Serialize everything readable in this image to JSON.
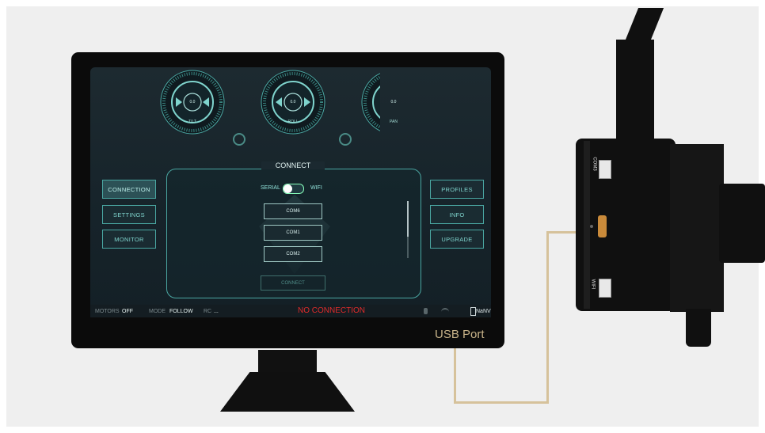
{
  "labels": {
    "usb_port": "USB Port"
  },
  "gimbal": {
    "port_top_label": "COM3",
    "port_bottom_label": "WIFI"
  },
  "dials": [
    {
      "label": "TILT",
      "value": "0.0"
    },
    {
      "label": "ROLL",
      "value": "0.0"
    },
    {
      "label": "PAN",
      "value": "0.0"
    }
  ],
  "left_nav": [
    "CONNECTION",
    "SETTINGS",
    "MONITOR"
  ],
  "right_nav": [
    "PROFILES",
    "INFO",
    "UPGRADE"
  ],
  "connect_panel": {
    "title": "CONNECT",
    "toggle_left": "SERIAL",
    "toggle_right": "WIFI",
    "ports": [
      "COM6",
      "COM1",
      "COM2"
    ],
    "connect_button": "CONNECT"
  },
  "status_bar": {
    "motors_label": "MOTORS",
    "motors_value": "OFF",
    "mode_label": "MODE",
    "mode_value": "FOLLOW",
    "rc_label": "RC",
    "rc_value": "...",
    "connection_status": "NO CONNECTION",
    "battery_value": "NaNV"
  },
  "colors": {
    "accent": "#4aa7a2",
    "error": "#e02b2b",
    "cable": "#d6c29b",
    "usb_label": "#c9b48a"
  }
}
